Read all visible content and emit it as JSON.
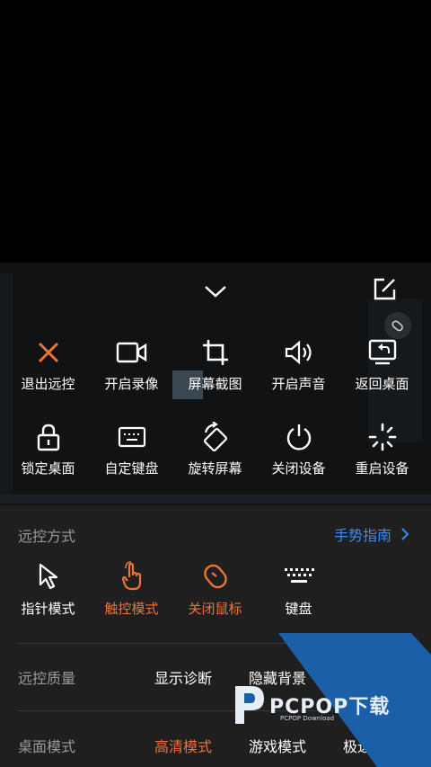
{
  "toolbar": {
    "actions_row1": [
      {
        "label": "退出远控",
        "icon": "close-icon"
      },
      {
        "label": "开启录像",
        "icon": "video-camera-icon"
      },
      {
        "label": "屏幕截图",
        "icon": "crop-icon"
      },
      {
        "label": "开启声音",
        "icon": "speaker-icon"
      },
      {
        "label": "返回桌面",
        "icon": "monitor-return-icon"
      }
    ],
    "actions_row2": [
      {
        "label": "锁定桌面",
        "icon": "lock-icon"
      },
      {
        "label": "自定键盘",
        "icon": "keyboard-icon"
      },
      {
        "label": "旋转屏幕",
        "icon": "rotate-screen-icon"
      },
      {
        "label": "关闭设备",
        "icon": "power-icon"
      },
      {
        "label": "重启设备",
        "icon": "restart-icon"
      }
    ]
  },
  "control_mode": {
    "title": "远控方式",
    "guide_label": "手势指南",
    "modes": [
      {
        "label": "指针模式",
        "icon": "pointer-icon",
        "active": false
      },
      {
        "label": "触控模式",
        "icon": "touch-hand-icon",
        "active": true
      },
      {
        "label": "关闭鼠标",
        "icon": "mouse-icon",
        "active": true
      },
      {
        "label": "键盘",
        "icon": "keyboard-icon",
        "active": false
      }
    ]
  },
  "quality": {
    "title": "远控质量",
    "options": [
      "显示诊断",
      "隐藏背景"
    ]
  },
  "desktop_mode": {
    "title": "桌面模式",
    "options": [
      {
        "label": "高清模式",
        "active": true
      },
      {
        "label": "游戏模式",
        "active": false
      },
      {
        "label": "极速",
        "active": false
      }
    ]
  },
  "watermark": {
    "brand": "PCPOP下载",
    "sub": "PCPOP Download"
  },
  "colors": {
    "accent_orange": "#f0733a",
    "link_blue": "#3d8bf0",
    "watermark_blue": "#1a5fa8"
  }
}
